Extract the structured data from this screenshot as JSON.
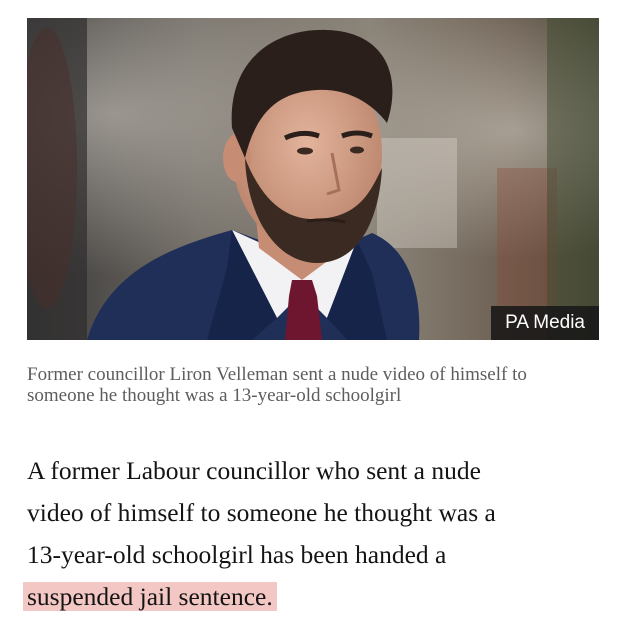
{
  "photo": {
    "credit": "PA Media",
    "description_icon": "person-portrait-image"
  },
  "caption": "Former councillor Liron Velleman sent a nude video of himself to someone he thought was a 13-year-old schoolgirl",
  "article": {
    "lede_lines": [
      "A former Labour councillor who sent a nude",
      "video of himself to someone he thought was a",
      "13-year-old schoolgirl has been handed a"
    ],
    "highlighted_text": "suspended jail sentence.",
    "highlight_color": "#f3c7c4"
  }
}
